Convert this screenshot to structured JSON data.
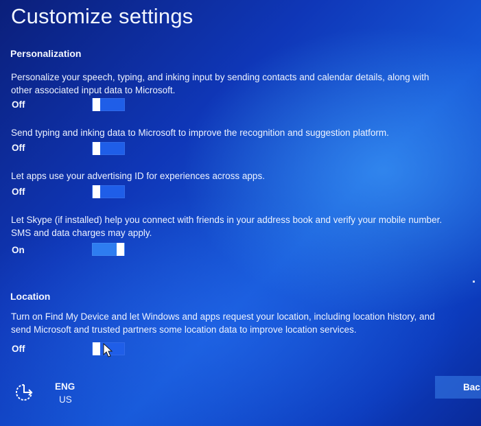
{
  "page": {
    "title": "Customize settings"
  },
  "personalization": {
    "heading": "Personalization",
    "settings": [
      {
        "description": "Personalize your speech, typing, and inking input by sending contacts and calendar details, along with other associated input data to Microsoft.",
        "state": "Off",
        "enabled": false
      },
      {
        "description": "Send typing and inking data to Microsoft to improve the recognition and suggestion platform.",
        "state": "Off",
        "enabled": false
      },
      {
        "description": "Let apps use your advertising ID for experiences across apps.",
        "state": "Off",
        "enabled": false
      },
      {
        "description": "Let Skype (if installed) help you connect with friends in your address book and verify your mobile number. SMS and data charges may apply.",
        "state": "On",
        "enabled": true
      }
    ]
  },
  "location": {
    "heading": "Location",
    "settings": [
      {
        "description": "Turn on Find My Device and let Windows and apps request your location, including location history, and send Microsoft and trusted partners some location data to improve location services.",
        "state": "Off",
        "enabled": false
      }
    ]
  },
  "footer": {
    "accessibility_icon": "ease-of-access-icon",
    "language_code": "ENG",
    "language_region": "US",
    "back_label": "Bac"
  },
  "colors": {
    "background_dark": "#0b1f7a",
    "background_mid": "#1658d8",
    "toggle_track": "#1f5ee8",
    "toggle_knob": "#ffffff",
    "text": "#ffffff"
  }
}
